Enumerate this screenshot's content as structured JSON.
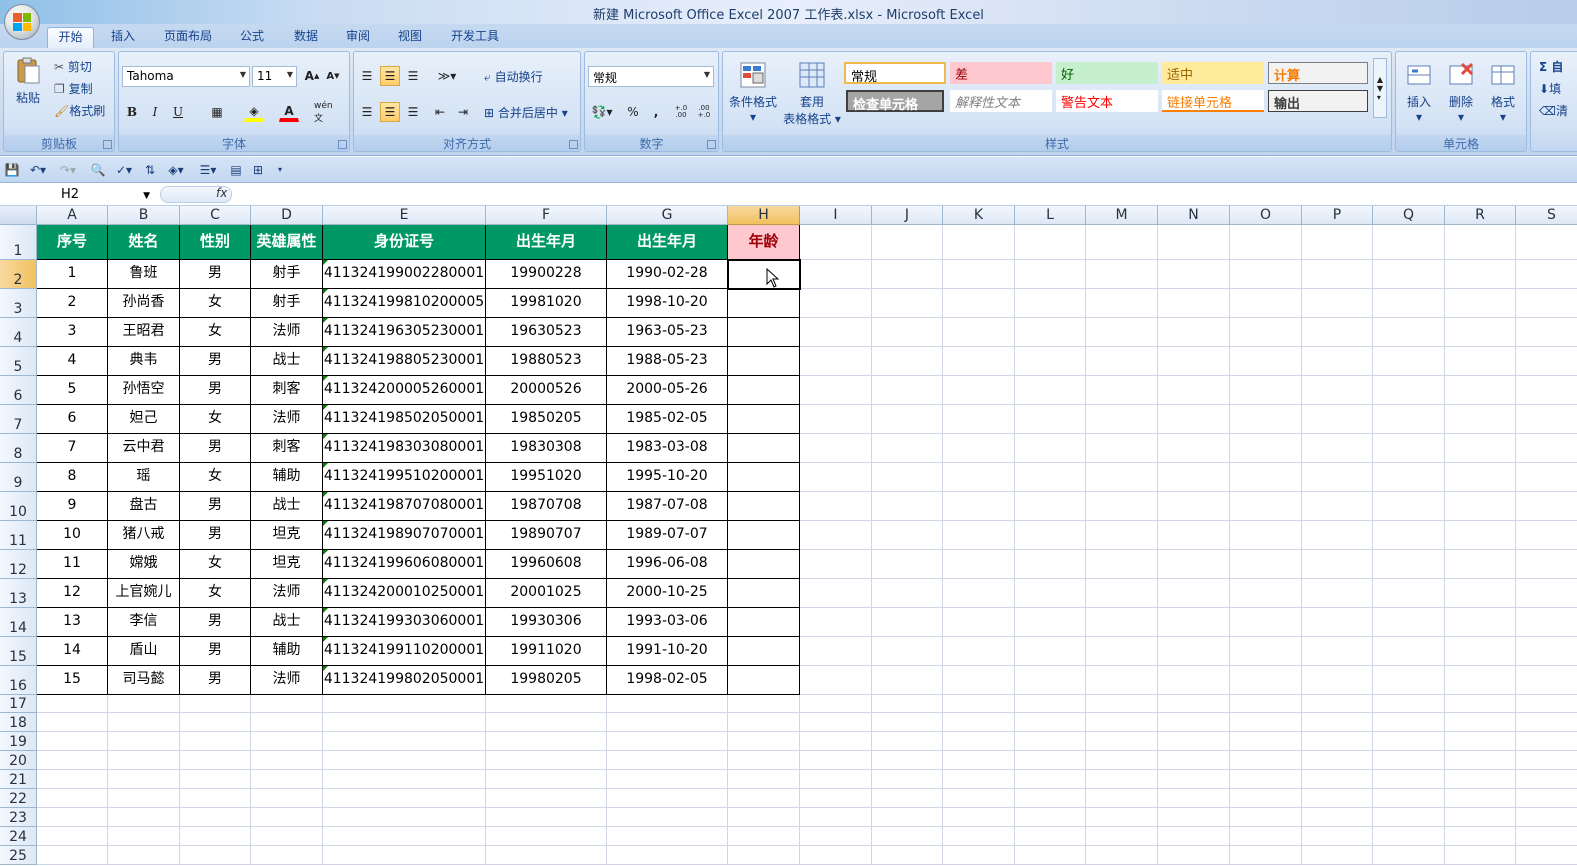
{
  "window": {
    "title": "新建 Microsoft Office Excel 2007 工作表.xlsx - Microsoft Excel"
  },
  "tabs": [
    {
      "label": "开始",
      "active": true
    },
    {
      "label": "插入"
    },
    {
      "label": "页面布局"
    },
    {
      "label": "公式"
    },
    {
      "label": "数据"
    },
    {
      "label": "审阅"
    },
    {
      "label": "视图"
    },
    {
      "label": "开发工具"
    }
  ],
  "ribbon": {
    "clipboard": {
      "label": "剪贴板",
      "paste": "粘贴",
      "cut": "剪切",
      "copy": "复制",
      "format_painter": "格式刷"
    },
    "font": {
      "label": "字体",
      "name": "Tahoma",
      "size": "11",
      "bold": "B",
      "italic": "I",
      "underline": "U",
      "grow": "A",
      "shrink": "A",
      "wen": "wén 文"
    },
    "alignment": {
      "label": "对齐方式",
      "wrap": "自动换行",
      "merge": "合并后居中"
    },
    "number": {
      "label": "数字",
      "format": "常规",
      "percent": "%",
      "comma": ",",
      "inc": "+.0 .00",
      "dec": ".00 +.0"
    },
    "styles": {
      "label": "样式",
      "conditional": "条件格式",
      "table_line1": "套用",
      "table_line2": "表格格式",
      "items": [
        {
          "label": "常规"
        },
        {
          "label": "差"
        },
        {
          "label": "好"
        },
        {
          "label": "适中"
        },
        {
          "label": "计算"
        },
        {
          "label": "检查单元格"
        },
        {
          "label": "解释性文本"
        },
        {
          "label": "警告文本"
        },
        {
          "label": "链接单元格"
        },
        {
          "label": "输出"
        }
      ]
    },
    "cells": {
      "label": "单元格",
      "insert": "插入",
      "delete": "删除",
      "format": "格式"
    },
    "editing": {
      "sum": "Σ 自",
      "fill": "填",
      "clear": "清"
    }
  },
  "formula_bar": {
    "name_box": "H2",
    "fx": "fx",
    "value": ""
  },
  "columns": [
    "A",
    "B",
    "C",
    "D",
    "E",
    "F",
    "G",
    "H",
    "I",
    "J",
    "K",
    "L",
    "M",
    "N",
    "O",
    "P",
    "Q",
    "R",
    "S"
  ],
  "rows": [
    "1",
    "2",
    "3",
    "4",
    "5",
    "6",
    "7",
    "8",
    "9",
    "10",
    "11",
    "12",
    "13",
    "14",
    "15",
    "16",
    "17",
    "18",
    "19",
    "20",
    "21",
    "22",
    "23",
    "24",
    "25"
  ],
  "selected": {
    "column": "H",
    "row": "2",
    "cell": "H2"
  },
  "table": {
    "headers": [
      "序号",
      "姓名",
      "性别",
      "英雄属性",
      "身份证号",
      "出生年月",
      "出生年月",
      "年龄"
    ],
    "rows": [
      [
        "1",
        "鲁班",
        "男",
        "射手",
        "411324199002280001",
        "19900228",
        "1990-02-28",
        ""
      ],
      [
        "2",
        "孙尚香",
        "女",
        "射手",
        "411324199810200005",
        "19981020",
        "1998-10-20",
        ""
      ],
      [
        "3",
        "王昭君",
        "女",
        "法师",
        "411324196305230001",
        "19630523",
        "1963-05-23",
        ""
      ],
      [
        "4",
        "典韦",
        "男",
        "战士",
        "411324198805230001",
        "19880523",
        "1988-05-23",
        ""
      ],
      [
        "5",
        "孙悟空",
        "男",
        "刺客",
        "411324200005260001",
        "20000526",
        "2000-05-26",
        ""
      ],
      [
        "6",
        "妲己",
        "女",
        "法师",
        "411324198502050001",
        "19850205",
        "1985-02-05",
        ""
      ],
      [
        "7",
        "云中君",
        "男",
        "刺客",
        "411324198303080001",
        "19830308",
        "1983-03-08",
        ""
      ],
      [
        "8",
        "瑶",
        "女",
        "辅助",
        "411324199510200001",
        "19951020",
        "1995-10-20",
        ""
      ],
      [
        "9",
        "盘古",
        "男",
        "战士",
        "411324198707080001",
        "19870708",
        "1987-07-08",
        ""
      ],
      [
        "10",
        "猪八戒",
        "男",
        "坦克",
        "411324198907070001",
        "19890707",
        "1989-07-07",
        ""
      ],
      [
        "11",
        "嫦娥",
        "女",
        "坦克",
        "411324199606080001",
        "19960608",
        "1996-06-08",
        ""
      ],
      [
        "12",
        "上官婉儿",
        "女",
        "法师",
        "411324200010250001",
        "20001025",
        "2000-10-25",
        ""
      ],
      [
        "13",
        "李信",
        "男",
        "战士",
        "411324199303060001",
        "19930306",
        "1993-03-06",
        ""
      ],
      [
        "14",
        "盾山",
        "男",
        "辅助",
        "411324199110200001",
        "19911020",
        "1991-10-20",
        ""
      ],
      [
        "15",
        "司马懿",
        "男",
        "法师",
        "411324199802050001",
        "19980205",
        "1998-02-05",
        ""
      ]
    ]
  },
  "colors": {
    "header_fill": "#009966",
    "age_fill": "#ffc7ce",
    "age_text": "#9c0006",
    "ribbon": "#c8daf0"
  }
}
